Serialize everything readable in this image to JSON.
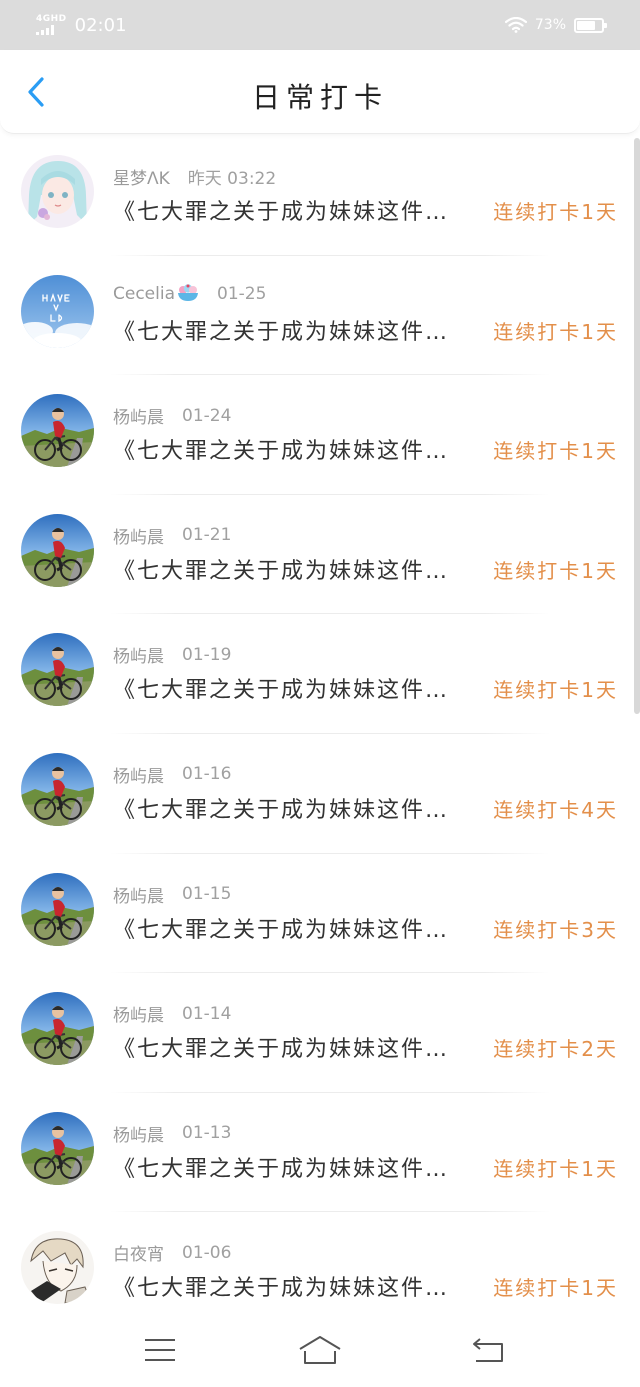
{
  "status_bar": {
    "network": "4GHD",
    "time": "02:01",
    "battery_percent_label": "73%",
    "battery_level": 0.73
  },
  "header": {
    "title": "日常打卡",
    "back_icon": "chevron-left-icon"
  },
  "colors": {
    "accent_blue": "#2a9df4",
    "streak_orange": "#e38f4a",
    "meta_gray": "#a0a0a0",
    "text_dark": "#333333"
  },
  "records": [
    {
      "name": "星梦ΛK",
      "date": "昨天 03:22",
      "title": "《七大罪之关于成为妹妹这件…",
      "streak": "连续打卡1天",
      "avatar": "anime-girl-avatar"
    },
    {
      "name": "Cecelia",
      "date": "01-25",
      "title": "《七大罪之关于成为妹妹这件…",
      "streak": "连续打卡1天",
      "avatar": "sky-avatar",
      "name_emoji": "bowl-emoji-icon"
    },
    {
      "name": "杨屿晨",
      "date": "01-24",
      "title": "《七大罪之关于成为妹妹这件…",
      "streak": "连续打卡1天",
      "avatar": "cyclist-avatar"
    },
    {
      "name": "杨屿晨",
      "date": "01-21",
      "title": "《七大罪之关于成为妹妹这件…",
      "streak": "连续打卡1天",
      "avatar": "cyclist-avatar"
    },
    {
      "name": "杨屿晨",
      "date": "01-19",
      "title": "《七大罪之关于成为妹妹这件…",
      "streak": "连续打卡1天",
      "avatar": "cyclist-avatar"
    },
    {
      "name": "杨屿晨",
      "date": "01-16",
      "title": "《七大罪之关于成为妹妹这件…",
      "streak": "连续打卡4天",
      "avatar": "cyclist-avatar"
    },
    {
      "name": "杨屿晨",
      "date": "01-15",
      "title": "《七大罪之关于成为妹妹这件…",
      "streak": "连续打卡3天",
      "avatar": "cyclist-avatar"
    },
    {
      "name": "杨屿晨",
      "date": "01-14",
      "title": "《七大罪之关于成为妹妹这件…",
      "streak": "连续打卡2天",
      "avatar": "cyclist-avatar"
    },
    {
      "name": "杨屿晨",
      "date": "01-13",
      "title": "《七大罪之关于成为妹妹这件…",
      "streak": "连续打卡1天",
      "avatar": "cyclist-avatar"
    },
    {
      "name": "白夜宵",
      "date": "01-06",
      "title": "《七大罪之关于成为妹妹这件…",
      "streak": "连续打卡1天",
      "avatar": "sketch-avatar"
    }
  ],
  "navbar": {
    "menu_icon": "menu-icon",
    "home_icon": "home-icon",
    "back_icon": "back-icon"
  }
}
